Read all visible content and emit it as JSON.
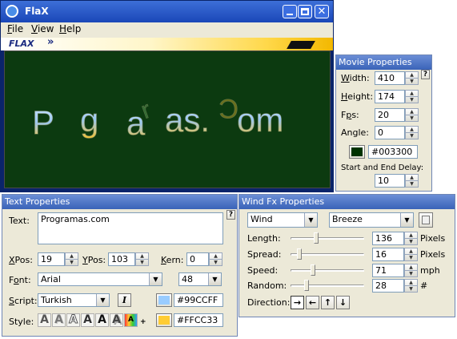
{
  "main_window": {
    "title": "FlaX",
    "menu": [
      "File",
      "View",
      "Help"
    ],
    "banner_logo": "FLAX",
    "banner_arrows": "»",
    "stage_text": "Programas.Com",
    "window_controls": [
      "minimize-icon",
      "maximize-icon",
      "close-icon"
    ]
  },
  "movie_properties": {
    "title": "Movie Properties",
    "width_label": "Width:",
    "width_value": "410",
    "height_label": "Height:",
    "height_value": "174",
    "fps_label": "Fps:",
    "fps_value": "20",
    "angle_label": "Angle:",
    "angle_value": "0",
    "color_value": "#003300",
    "delay_label": "Start and End Delay:",
    "delay_value": "10",
    "help": "?"
  },
  "text_properties": {
    "title": "Text Properties",
    "text_label": "Text:",
    "text_value": "Programas.com",
    "xpos_label": "XPos:",
    "xpos_value": "19",
    "ypos_label": "YPos:",
    "ypos_value": "103",
    "kern_label": "Kern:",
    "kern_value": "0",
    "font_label": "Font:",
    "font_value": "Arial",
    "size_value": "48",
    "script_label": "Script:",
    "script_value": "Turkish",
    "italic_glyph": "I",
    "color1_value": "#99CCFF",
    "style_label": "Style:",
    "style_glyph": "A",
    "color2_value": "#FFCC33",
    "help": "?",
    "plus": "+"
  },
  "wind_fx": {
    "title": "Wind Fx Properties",
    "effect_value": "Wind",
    "preset_value": "Breeze",
    "length_label": "Length:",
    "length_value": "136",
    "length_unit": "Pixels",
    "spread_label": "Spread:",
    "spread_value": "16",
    "spread_unit": "Pixels",
    "speed_label": "Speed:",
    "speed_value": "71",
    "speed_unit": "mph",
    "random_label": "Random:",
    "random_value": "28",
    "random_unit": "#",
    "direction_label": "Direction:",
    "directions": [
      "→",
      "←",
      "↑",
      "↓"
    ],
    "slider_levels": [
      0.35,
      0.12,
      0.3,
      0.22
    ]
  },
  "colors": {
    "stage": "#0c3a10",
    "titlebar": "#3a63b8",
    "movie_bg": "#003300",
    "text_color1": "#99CCFF",
    "text_color2": "#FFCC33"
  }
}
